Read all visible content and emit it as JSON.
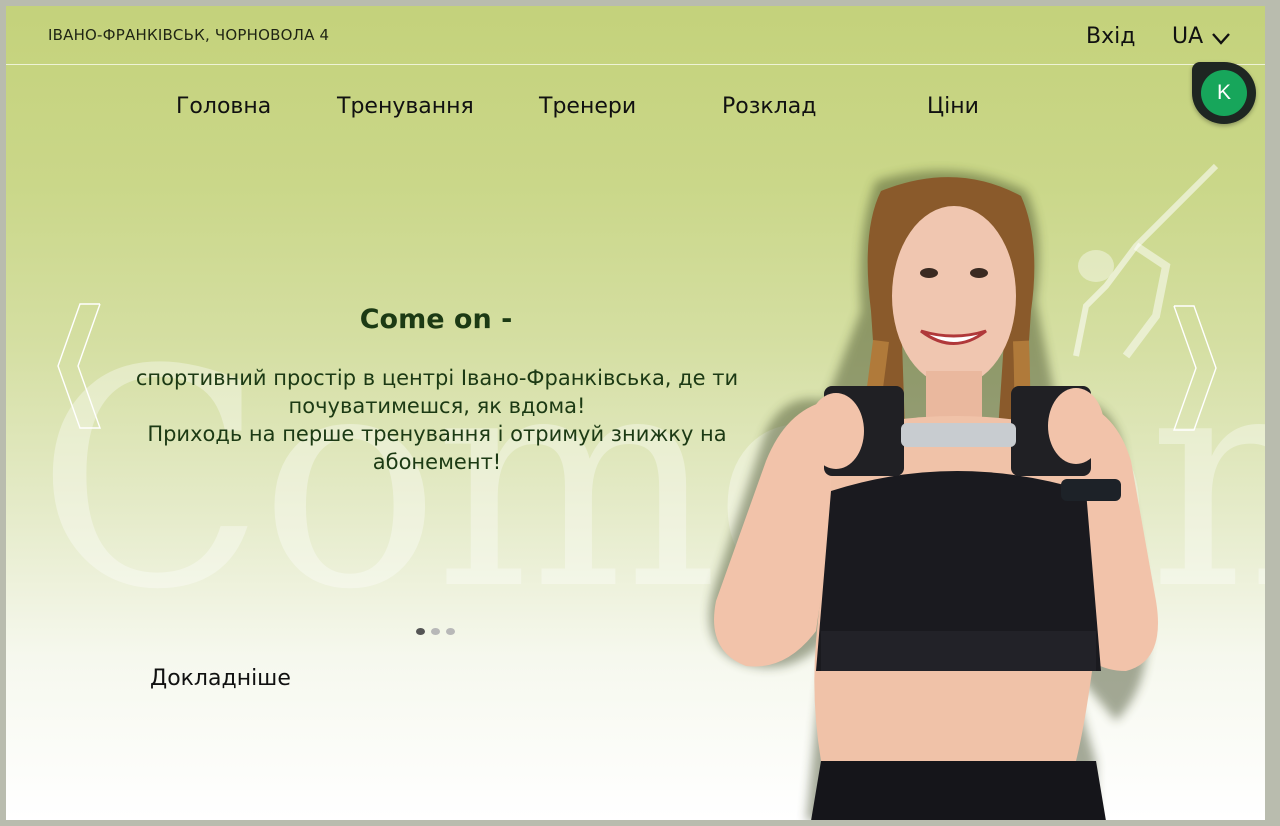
{
  "header": {
    "address": "ІВАНО-ФРАНКІВСЬК, ЧОРНОВОЛА 4",
    "login_label": "Вхід",
    "language": "UA"
  },
  "nav": {
    "items": [
      "Головна",
      "Тренування",
      "Тренери",
      "Розклад",
      "Ціни"
    ]
  },
  "badge": {
    "letter": "K",
    "color": "#17a65b"
  },
  "hero": {
    "watermark": "Come on",
    "headline": "Come on -",
    "subtitle_line1": "спортивний простір в центрі Івано-Франківська, де ти почуватимешся, як вдома!",
    "subtitle_line2": "Приходь на перше тренування і отримуй знижку на абонемент!",
    "more_label": "Докладніше",
    "slides_total": 3,
    "slide_active": 1
  },
  "colors": {
    "header_bg": "#c4d27b",
    "headline": "#1c3a14"
  }
}
